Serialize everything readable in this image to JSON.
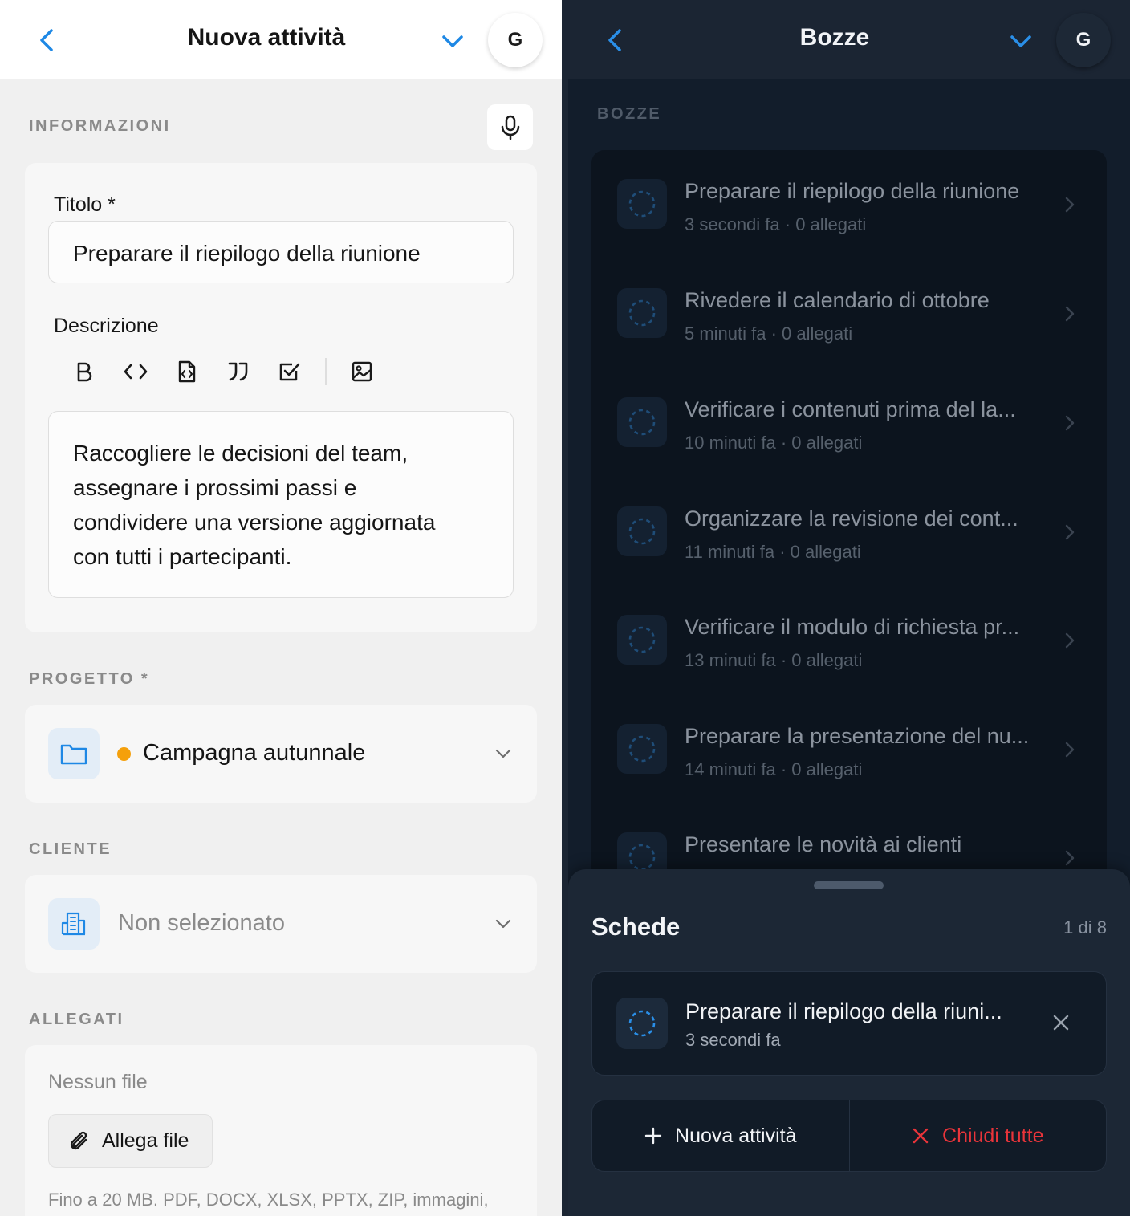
{
  "left": {
    "header": {
      "title": "Nuova attività",
      "avatar": "G"
    },
    "sections": {
      "info": "INFORMAZIONI",
      "project": "PROGETTO *",
      "client": "CLIENTE",
      "attachments": "ALLEGATI"
    },
    "form": {
      "title_label": "Titolo *",
      "title_value": "Preparare il riepilogo della riunione",
      "description_label": "Descrizione",
      "description_lines": [
        "Raccogliere le decisioni del team,",
        "assegnare i prossimi passi e",
        "condividere una versione aggiornata",
        "con tutti i partecipanti."
      ]
    },
    "toolbar_icons": [
      "bold-icon",
      "code-icon",
      "code-block-icon",
      "quote-icon",
      "checkbox-icon",
      "image-icon"
    ],
    "project": {
      "name": "Campagna autunnale",
      "color": "#f5a00b"
    },
    "client": {
      "value": "Non selezionato"
    },
    "attachments": {
      "empty": "Nessun file",
      "button": "Allega file",
      "hint": "Fino a 20 MB. PDF, DOCX, XLSX, PPTX, ZIP, immagini,"
    }
  },
  "right": {
    "header": {
      "title": "Bozze",
      "avatar": "G"
    },
    "section": "BOZZE",
    "drafts": [
      {
        "title": "Preparare il riepilogo della riunione",
        "meta": "3 secondi fa · 0 allegati"
      },
      {
        "title": "Rivedere il calendario di ottobre",
        "meta": "5 minuti fa · 0 allegati"
      },
      {
        "title": "Verificare i contenuti prima del la...",
        "meta": "10 minuti fa · 0 allegati"
      },
      {
        "title": "Organizzare la revisione dei cont...",
        "meta": "11 minuti fa · 0 allegati"
      },
      {
        "title": "Verificare il modulo di richiesta pr...",
        "meta": "13 minuti fa · 0 allegati"
      },
      {
        "title": "Preparare la presentazione del nu...",
        "meta": "14 minuti fa · 0 allegati"
      },
      {
        "title": "Presentare le novità ai clienti",
        "meta": ""
      }
    ],
    "sheet": {
      "title": "Schede",
      "count": "1 di 8",
      "tab": {
        "title": "Preparare il riepilogo della riuni...",
        "meta": "3 secondi fa"
      },
      "new_label": "Nuova attività",
      "close_all_label": "Chiudi tutte"
    }
  },
  "colors": {
    "accent": "#1e88e5",
    "danger": "#e8343a",
    "project_dot": "#f5a00b"
  }
}
